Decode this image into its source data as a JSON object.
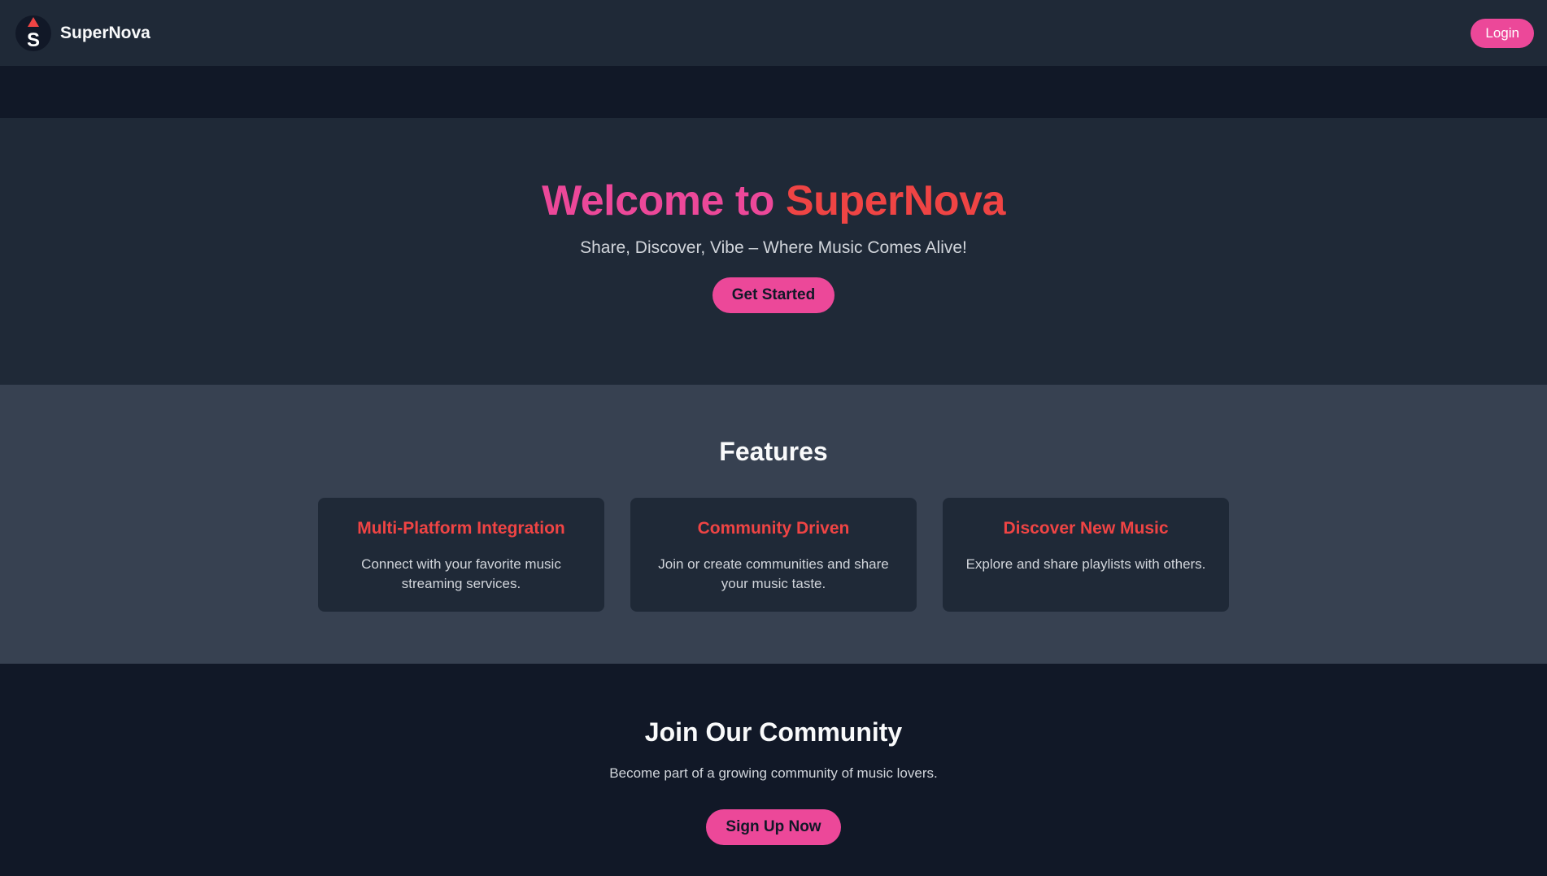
{
  "navbar": {
    "brand_name": "SuperNova",
    "logo_letter": "S",
    "login_label": "Login"
  },
  "hero": {
    "title_part1": "Welcome to",
    "title_part2": "SuperNova",
    "subtitle": "Share, Discover, Vibe – Where Music Comes Alive!",
    "cta_label": "Get Started"
  },
  "features": {
    "heading": "Features",
    "cards": [
      {
        "title": "Multi-Platform Integration",
        "text": "Connect with your favorite music streaming services."
      },
      {
        "title": "Community Driven",
        "text": "Join or create communities and share your music taste."
      },
      {
        "title": "Discover New Music",
        "text": "Explore and share playlists with others."
      }
    ]
  },
  "community": {
    "heading": "Join Our Community",
    "subtitle": "Become part of a growing community of music lovers.",
    "cta_label": "Sign Up Now"
  },
  "colors": {
    "accent_pink": "#ec4899",
    "accent_red": "#ef4444",
    "nav_bg": "#1f2937",
    "page_bg": "#111827",
    "features_bg": "#374151"
  },
  "icons": {
    "logo": "supernova-logo-icon"
  }
}
